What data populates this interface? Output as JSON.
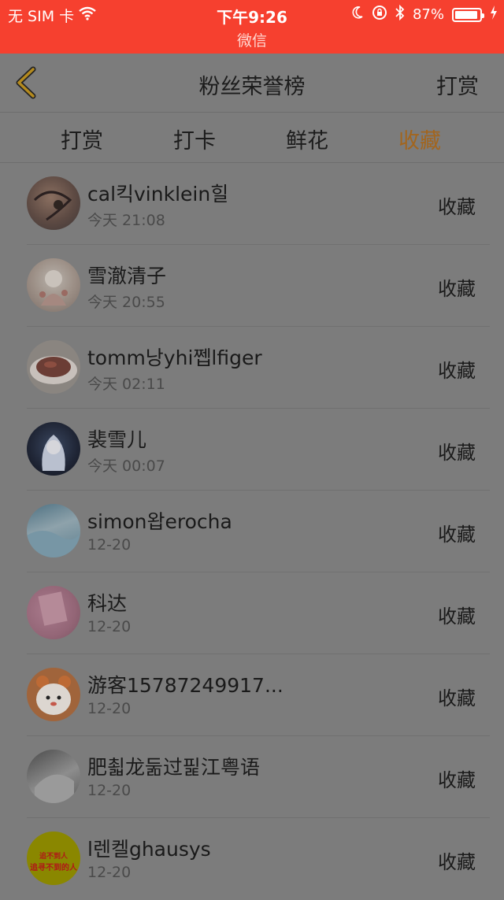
{
  "status_bar": {
    "carrier": "无 SIM 卡",
    "time": "下午9:26",
    "app": "微信",
    "battery": "87%"
  },
  "nav": {
    "title": "粉丝荣誉榜",
    "right_button": "打赏"
  },
  "tabs": [
    {
      "label": "打赏",
      "active": false
    },
    {
      "label": "打卡",
      "active": false
    },
    {
      "label": "鲜花",
      "active": false
    },
    {
      "label": "收藏",
      "active": true
    }
  ],
  "colors": {
    "status_bar": "#f6402f",
    "active_tab": "#a2651e",
    "overlay_bg": "#7c7c7c"
  },
  "fans": [
    {
      "name": "cal킥vinklein힐",
      "time": "今天 21:08",
      "action": "收藏"
    },
    {
      "name": "雪澈清子",
      "time": "今天 20:55",
      "action": "收藏"
    },
    {
      "name": "tomm낭yhi쩹lfiger",
      "time": "今天 02:11",
      "action": "收藏"
    },
    {
      "name": "裴雪儿",
      "time": "今天 00:07",
      "action": "收藏"
    },
    {
      "name": "simon왑erocha",
      "time": "12-20",
      "action": "收藏"
    },
    {
      "name": "科达",
      "time": "12-20",
      "action": "收藏"
    },
    {
      "name": "游客15787249917...",
      "time": "12-20",
      "action": "收藏"
    },
    {
      "name": "肥쵧龙둚过핉江粤语",
      "time": "12-20",
      "action": "收藏"
    },
    {
      "name": "l렌켈ghausys",
      "time": "12-20",
      "action": "收藏",
      "avatar_text": [
        "追不到人",
        "追寻不到的人"
      ]
    }
  ]
}
